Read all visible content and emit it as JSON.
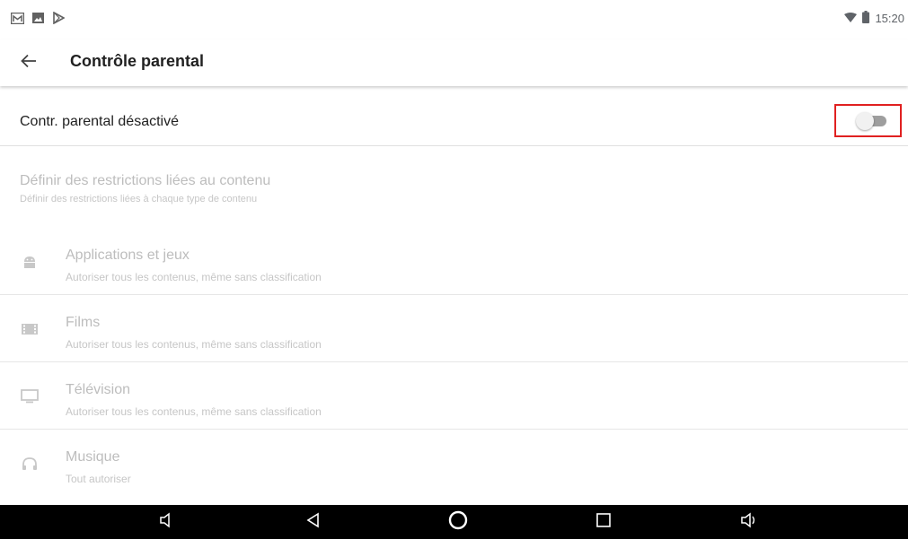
{
  "status_bar": {
    "left_icons": [
      "gallery-icon",
      "image-icon",
      "play-store-icon"
    ],
    "wifi_icon": "wifi-icon",
    "battery_icon": "battery-icon",
    "time": "15:20"
  },
  "app_bar": {
    "back_icon": "back-arrow-icon",
    "title": "Contrôle parental"
  },
  "master_switch": {
    "label": "Contr. parental désactivé",
    "enabled": false,
    "highlight_color": "#e02020"
  },
  "content_restrictions": {
    "title": "Définir des restrictions liées au contenu",
    "subtitle": "Définir des restrictions liées à chaque type de contenu"
  },
  "categories": [
    {
      "icon": "android-icon",
      "title": "Applications et jeux",
      "subtitle": "Autoriser tous les contenus, même sans classification"
    },
    {
      "icon": "film-icon",
      "title": "Films",
      "subtitle": "Autoriser tous les contenus, même sans classification"
    },
    {
      "icon": "tv-icon",
      "title": "Télévision",
      "subtitle": "Autoriser tous les contenus, même sans classification"
    },
    {
      "icon": "headphones-icon",
      "title": "Musique",
      "subtitle": "Tout autoriser"
    }
  ],
  "nav_bar": {
    "buttons": [
      "volume-down-icon",
      "back-icon",
      "home-icon",
      "recents-icon",
      "volume-up-icon"
    ]
  },
  "colors": {
    "primary_text": "#212121",
    "disabled_text": "#bdbdbd",
    "divider": "#e0e0e0",
    "nav_bar": "#000000"
  }
}
